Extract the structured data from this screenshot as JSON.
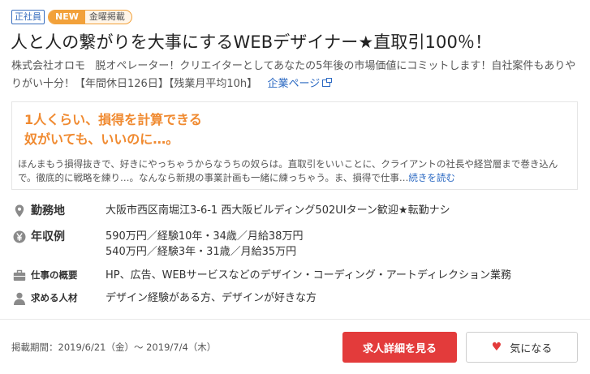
{
  "tags": {
    "employment_type": "正社員",
    "new_badge": "NEW",
    "day_badge": "金曜掲載"
  },
  "job": {
    "title": "人と人の繋がりを大事にするWEBデザイナー★直取引100％！",
    "company": "株式会社オロモ",
    "catch": "脱オペレーター！クリエイターとしてあなたの5年後の市場価値にコミットします！自社案件もありやりがい十分！【年間休日126日】【残業月平均10h】",
    "company_link": "企業ページ"
  },
  "pr": {
    "heading_line1": "1人くらい、損得を計算できる",
    "heading_line2": "奴がいても、いいのに…。",
    "body": "ほんまもう損得抜きで、好きにやっちゃうからなうちの奴らは。直取引をいいことに、クライアントの社長や経営層まで巻き込んで。徹底的に戦略を練り…。なんなら新規の事業計画も一緒に練っちゃう。ま、損得で仕事…",
    "more_link": "続きを読む"
  },
  "details": {
    "location": {
      "label": "勤務地",
      "icon": "map-pin-icon",
      "value": "大阪市西区南堀江3-6-1 西大阪ビルディング502UIターン歓迎★転勤ナシ"
    },
    "salary": {
      "label": "年収例",
      "icon": "yen-icon",
      "line1": "590万円／経験10年・34歳／月給38万円",
      "line2": "540万円／経験3年・31歳／月給35万円"
    },
    "work": {
      "label": "仕事の概要",
      "icon": "briefcase-icon",
      "value": "HP、広告、WEBサービスなどのデザイン・コーディング・アートディレクション業務"
    },
    "requirement": {
      "label": "求める人材",
      "icon": "person-icon",
      "value": "デザイン経験がある方、デザインが好きな方"
    }
  },
  "footer": {
    "period": "掲載期間：2019/6/21（金）～ 2019/7/4（木）",
    "apply_button": "求人詳細を見る",
    "favorite_button": "気になる"
  },
  "colors": {
    "accent_orange": "#f08a30",
    "link_blue": "#2a68c2",
    "apply_red": "#e33b3b"
  }
}
